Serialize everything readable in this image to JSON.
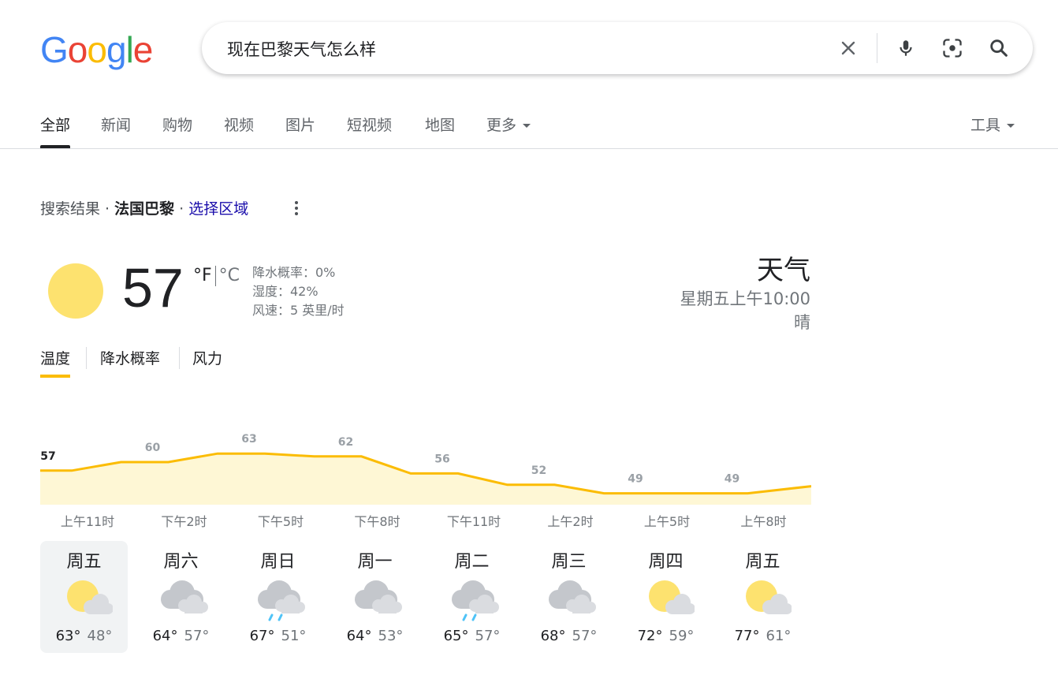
{
  "logo": {
    "letters": [
      "G",
      "o",
      "o",
      "g",
      "l",
      "e"
    ],
    "colors": [
      "#4285f4",
      "#ea4335",
      "#fbbc05",
      "#4285f4",
      "#34a853",
      "#ea4335"
    ]
  },
  "search": {
    "query": "现在巴黎天气怎么样",
    "icons": [
      "close-icon",
      "microphone-icon",
      "camera-lens-icon",
      "search-icon"
    ]
  },
  "tabs": [
    {
      "label": "全部",
      "active": true
    },
    {
      "label": "新闻"
    },
    {
      "label": "购物"
    },
    {
      "label": "视频"
    },
    {
      "label": "图片"
    },
    {
      "label": "短视频"
    },
    {
      "label": "地图"
    },
    {
      "label": "更多"
    }
  ],
  "tools_label": "工具",
  "result_header": {
    "prefix": "搜索结果 · ",
    "location": "法国巴黎",
    "sep": " · ",
    "link": "选择区域"
  },
  "current": {
    "temp": "57",
    "unit_f": "°F",
    "unit_c": "°C",
    "precip": "降水概率：0%",
    "humidity": "湿度：42%",
    "wind": "风速：5 英里/时"
  },
  "weather_title": {
    "title": "天气",
    "time": "星期五上午10:00",
    "condition": "晴"
  },
  "weather_tabs": [
    "温度",
    "降水概率",
    "风力"
  ],
  "chart_data": {
    "type": "area",
    "x": [
      "上午11时",
      "下午2时",
      "下午5时",
      "下午8时",
      "下午11时",
      "上午2时",
      "上午5时",
      "上午8时"
    ],
    "values": [
      57,
      60,
      63,
      62,
      56,
      52,
      49,
      49
    ],
    "ylim": [
      45,
      70
    ],
    "line_color": "#fbbc04",
    "fill_color": "#fef7d5"
  },
  "days": [
    {
      "name": "周五",
      "icon": "partly-cloudy",
      "hi": "63°",
      "lo": "48°",
      "active": true
    },
    {
      "name": "周六",
      "icon": "cloudy",
      "hi": "64°",
      "lo": "57°"
    },
    {
      "name": "周日",
      "icon": "rain",
      "hi": "67°",
      "lo": "51°"
    },
    {
      "name": "周一",
      "icon": "cloudy",
      "hi": "64°",
      "lo": "53°"
    },
    {
      "name": "周二",
      "icon": "rain",
      "hi": "65°",
      "lo": "57°"
    },
    {
      "name": "周三",
      "icon": "cloudy",
      "hi": "68°",
      "lo": "57°"
    },
    {
      "name": "周四",
      "icon": "partly-cloudy",
      "hi": "72°",
      "lo": "59°"
    },
    {
      "name": "周五",
      "icon": "partly-cloudy",
      "hi": "77°",
      "lo": "61°"
    }
  ]
}
